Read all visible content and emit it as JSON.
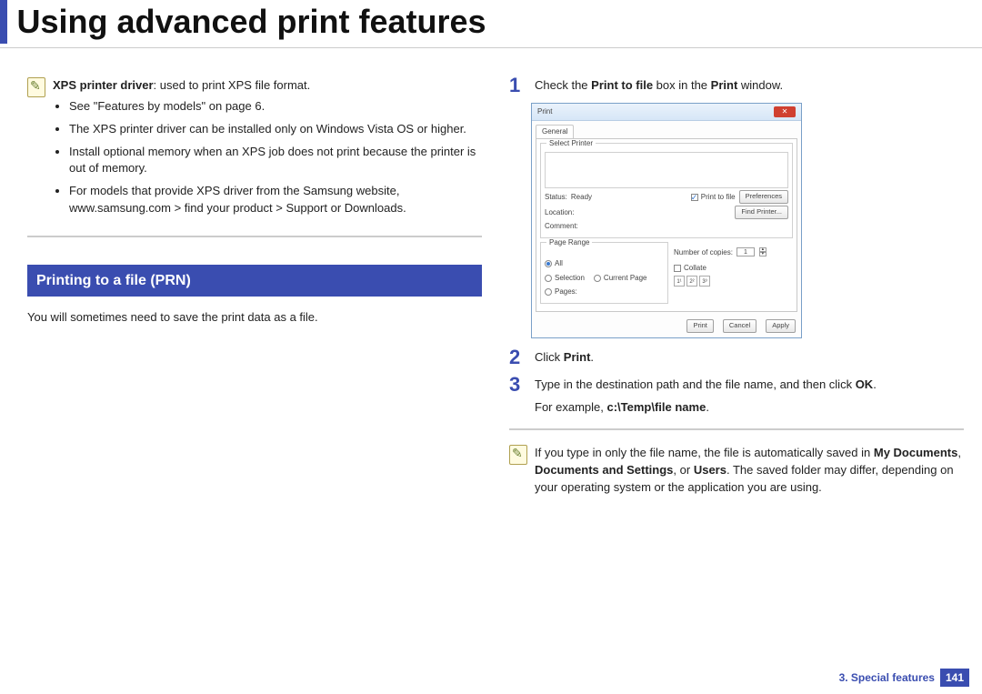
{
  "page_title": "Using advanced print features",
  "left_note": {
    "lead_bold": "XPS printer driver",
    "lead_rest": ": used to print XPS file format.",
    "bullets": [
      "See \"Features by models\" on page 6.",
      "The XPS printer driver can be installed only on Windows Vista OS or higher.",
      "Install optional memory when an XPS job does not print because the printer is out of memory.",
      "For models that provide XPS driver from the Samsung website, www.samsung.com > find your product > Support or Downloads."
    ]
  },
  "section_head": "Printing to a file (PRN)",
  "section_intro": "You will sometimes need to save the print data as a file.",
  "steps": [
    {
      "num": "1",
      "pre": "Check the ",
      "bold1": "Print to file",
      "mid": " box in the ",
      "bold2": "Print",
      "post": " window."
    },
    {
      "num": "2",
      "pre": "Click ",
      "bold1": "Print",
      "post": "."
    },
    {
      "num": "3",
      "pre": "Type in the destination path and the file name, and then click ",
      "bold1": "OK",
      "post": ".",
      "line2_pre": "For example, ",
      "line2_bold": "c:\\Temp\\file name",
      "line2_post": "."
    }
  ],
  "right_note": {
    "pre1": "If you type in only the file name, the file is automatically saved in ",
    "bold1": "My Documents",
    "sep1": ", ",
    "bold2": "Documents and Settings",
    "sep2": ", or ",
    "bold3": "Users",
    "post": ". The saved folder may differ, depending on your operating system or the application you are using."
  },
  "dialog": {
    "title": "Print",
    "close_x": "✕",
    "tab": "General",
    "group_select": "Select Printer",
    "status_lbl": "Status:",
    "status_val": "Ready",
    "location_lbl": "Location:",
    "comment_lbl": "Comment:",
    "print_to_file": "Print to file",
    "preferences": "Preferences",
    "find_printer": "Find Printer...",
    "page_range": "Page Range",
    "r_all": "All",
    "r_selection": "Selection",
    "r_current": "Current Page",
    "r_pages": "Pages:",
    "copies_lbl": "Number of copies:",
    "copies_val": "1",
    "collate": "Collate",
    "collate1": "1¹",
    "collate2": "2²",
    "collate3": "3³",
    "btn_print": "Print",
    "btn_cancel": "Cancel",
    "btn_apply": "Apply"
  },
  "footer": {
    "chapter": "3.  Special features",
    "page": "141"
  }
}
